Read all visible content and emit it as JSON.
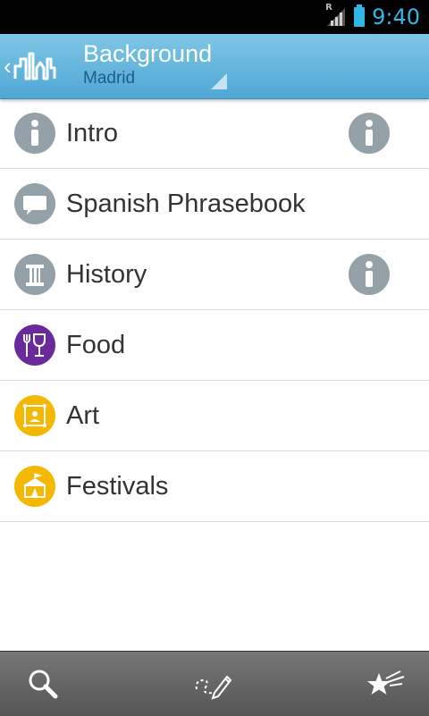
{
  "status_bar": {
    "time": "9:40",
    "signal_mark": "R",
    "icons": [
      "signal-icon",
      "battery-icon"
    ]
  },
  "action_bar": {
    "title": "Background",
    "subtitle": "Madrid",
    "logo_icon": "city-skyline-icon"
  },
  "list": {
    "items": [
      {
        "label": "Intro",
        "icon": "info-icon",
        "icon_bg": "#95a1a8",
        "has_info": true
      },
      {
        "label": "Spanish Phrasebook",
        "icon": "speech-bubble-icon",
        "icon_bg": "#95a1a8",
        "has_info": false
      },
      {
        "label": "History",
        "icon": "column-icon",
        "icon_bg": "#95a1a8",
        "has_info": true
      },
      {
        "label": "Food",
        "icon": "fork-wine-icon",
        "icon_bg": "#6a2a9c",
        "has_info": false
      },
      {
        "label": "Art",
        "icon": "painting-frame-icon",
        "icon_bg": "#f5b800",
        "has_info": false
      },
      {
        "label": "Festivals",
        "icon": "tent-icon",
        "icon_bg": "#f5b800",
        "has_info": false
      }
    ]
  },
  "bottom_bar": {
    "icons": [
      "search-icon",
      "draw-route-icon",
      "favorites-icon"
    ]
  },
  "colors": {
    "accent": "#33b5e5",
    "action_bar": "#5fb3dd",
    "food": "#6a2a9c",
    "art": "#f5b800"
  }
}
